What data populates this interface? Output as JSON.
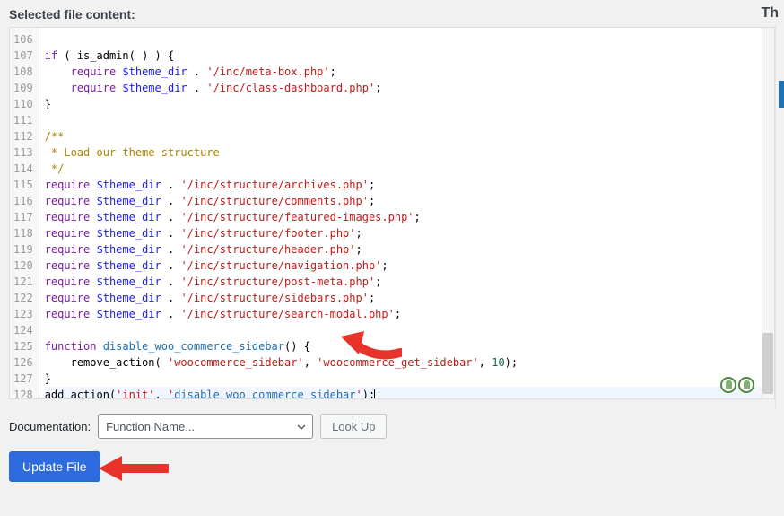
{
  "header": {
    "title": "Selected file content:",
    "right": "Th"
  },
  "gutter": {
    "start": 106,
    "end": 128
  },
  "code": {
    "lines": [
      "",
      "if ( is_admin( ) ) {",
      "    require $theme_dir . '/inc/meta-box.php';",
      "    require $theme_dir . '/inc/class-dashboard.php';",
      "}",
      "",
      "/**",
      " * Load our theme structure",
      " */",
      "require $theme_dir . '/inc/structure/archives.php';",
      "require $theme_dir . '/inc/structure/comments.php';",
      "require $theme_dir . '/inc/structure/featured-images.php';",
      "require $theme_dir . '/inc/structure/footer.php';",
      "require $theme_dir . '/inc/structure/header.php';",
      "require $theme_dir . '/inc/structure/navigation.php';",
      "require $theme_dir . '/inc/structure/post-meta.php';",
      "require $theme_dir . '/inc/structure/sidebars.php';",
      "require $theme_dir . '/inc/structure/search-modal.php';",
      "",
      "function disable_woo_commerce_sidebar() {",
      "    remove_action( 'woocommerce_sidebar', 'woocommerce_get_sidebar', 10);",
      "}",
      "add_action('init', 'disable_woo_commerce_sidebar');"
    ]
  },
  "footer": {
    "doc_label": "Documentation:",
    "select_placeholder": "Function Name...",
    "lookup_label": "Look Up",
    "update_label": "Update File"
  }
}
